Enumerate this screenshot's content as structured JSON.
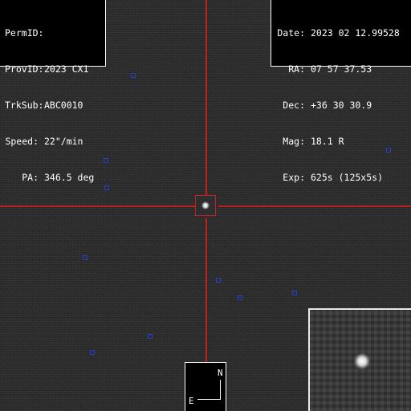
{
  "info_left": {
    "rows": [
      {
        "label": "PermID:",
        "value": ""
      },
      {
        "label": "ProvID:",
        "value": "2023 CX1"
      },
      {
        "label": "TrkSub:",
        "value": "ABC0010"
      },
      {
        "label": "Speed:",
        "value": "22\"/min"
      },
      {
        "label": "PA:",
        "value": "346.5 deg"
      }
    ]
  },
  "info_right": {
    "rows": [
      {
        "label": "Date:",
        "value": "2023 02 12.99528"
      },
      {
        "label": "RA:",
        "value": "07 57 37.53"
      },
      {
        "label": "Dec:",
        "value": "+36 30 30.9"
      },
      {
        "label": "Mag:",
        "value": "18.1 R"
      },
      {
        "label": "Exp:",
        "value": "625s (125x5s)"
      }
    ]
  },
  "compass": {
    "north_label": "N",
    "east_label": "E"
  },
  "colors": {
    "crosshair": "#cc1f1f",
    "marker": "#2540c8",
    "panel_bg": "#000000",
    "panel_text": "#ffffff"
  }
}
